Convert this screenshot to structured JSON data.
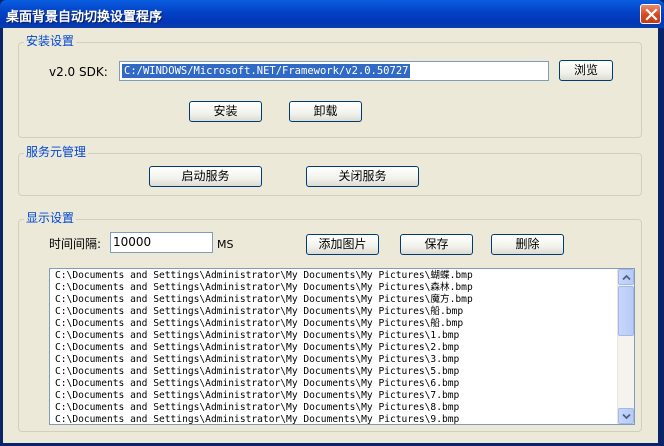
{
  "window": {
    "title": "桌面背景自动切换设置程序"
  },
  "install_group": {
    "title": "安装设置",
    "sdk_label": "v2.0 SDK:",
    "sdk_path": "C:/WINDOWS/Microsoft.NET/Framework/v2.0.50727",
    "browse_label": "浏览",
    "install_label": "安装",
    "uninstall_label": "卸载"
  },
  "service_group": {
    "title": "服务元管理",
    "start_label": "启动服务",
    "stop_label": "关闭服务"
  },
  "display_group": {
    "title": "显示设置",
    "interval_label": "时间间隔:",
    "interval_value": "10000",
    "unit_label": "MS",
    "add_label": "添加图片",
    "save_label": "保存",
    "delete_label": "删除",
    "images": [
      "C:\\Documents and Settings\\Administrator\\My Documents\\My Pictures\\蝴蝶.bmp",
      "C:\\Documents and Settings\\Administrator\\My Documents\\My Pictures\\森林.bmp",
      "C:\\Documents and Settings\\Administrator\\My Documents\\My Pictures\\魔方.bmp",
      "C:\\Documents and Settings\\Administrator\\My Documents\\My Pictures\\船.bmp",
      "C:\\Documents and Settings\\Administrator\\My Documents\\My Pictures\\船.bmp",
      "C:\\Documents and Settings\\Administrator\\My Documents\\My Pictures\\1.bmp",
      "C:\\Documents and Settings\\Administrator\\My Documents\\My Pictures\\2.bmp",
      "C:\\Documents and Settings\\Administrator\\My Documents\\My Pictures\\3.bmp",
      "C:\\Documents and Settings\\Administrator\\My Documents\\My Pictures\\5.bmp",
      "C:\\Documents and Settings\\Administrator\\My Documents\\My Pictures\\6.bmp",
      "C:\\Documents and Settings\\Administrator\\My Documents\\My Pictures\\7.bmp",
      "C:\\Documents and Settings\\Administrator\\My Documents\\My Pictures\\8.bmp",
      "C:\\Documents and Settings\\Administrator\\My Documents\\My Pictures\\9.bmp"
    ]
  },
  "icons": {
    "close": "close-icon",
    "scroll_up": "chevron-up-icon",
    "scroll_down": "chevron-down-icon"
  },
  "colors": {
    "titlebar": "#0341c4",
    "group_title": "#0046d5",
    "selection": "#316ac5",
    "client_bg": "#ece9d8"
  }
}
